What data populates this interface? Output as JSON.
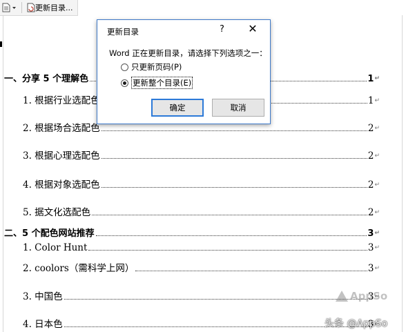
{
  "toolbar": {
    "update_label": "更新目录..."
  },
  "toc": {
    "entries": [
      {
        "label": "一、分享 5 个理解色",
        "page": "1",
        "level": 1
      },
      {
        "label": "1.  根据行业选配色",
        "page": "1",
        "level": 2
      },
      {
        "label": "2.  根据场合选配色",
        "page": "2",
        "level": 2
      },
      {
        "label": "3.  根据心理选配色",
        "page": "2",
        "level": 2
      },
      {
        "label": "4.  根据对象选配色",
        "page": "2",
        "level": 2
      },
      {
        "label": "5.  据文化选配色",
        "page": "2",
        "level": 2
      },
      {
        "label": "二、5 个配色网站推荐",
        "page": "3",
        "level": 1
      },
      {
        "label": "1. Color Hunt",
        "page": "3",
        "level": 2
      },
      {
        "label": "2. coolors（需科学上网）",
        "page": "3",
        "level": 2
      },
      {
        "label": "3.  中国色",
        "page": "3",
        "level": 2
      },
      {
        "label": "4.  日本色",
        "page": "3",
        "level": 2
      }
    ],
    "paragraph_mark": "↵"
  },
  "dialog": {
    "title": "更新目录",
    "help": "?",
    "close": "✕",
    "message": "Word 正在更新目录，请选择下列选项之一：",
    "options": [
      {
        "label": "只更新页码(P)",
        "checked": false
      },
      {
        "label": "更新整个目录(E)",
        "checked": true
      }
    ],
    "ok_label": "确定",
    "cancel_label": "取消"
  },
  "watermarks": {
    "brand": "AppSo",
    "source": "头条 @AppSo"
  }
}
